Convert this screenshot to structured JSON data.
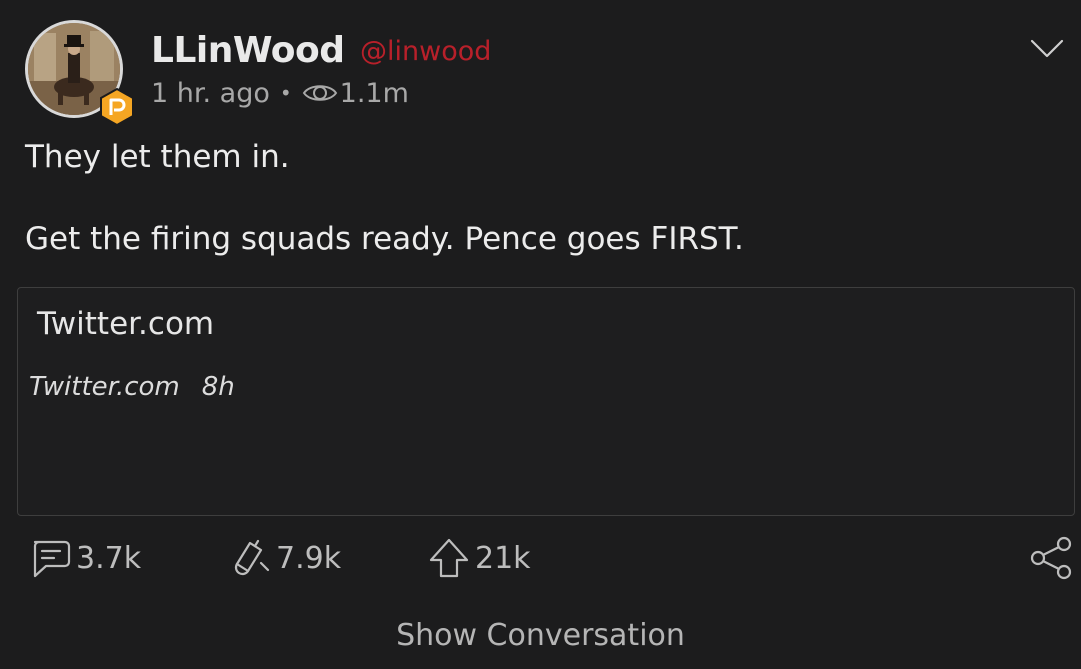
{
  "post": {
    "display_name": "LLinWood",
    "handle": "@linwood",
    "time_ago": "1 hr. ago",
    "separator": "•",
    "views": "1.1m",
    "text_line1": "They let them in.",
    "text_line2": "Get the firing squads ready. Pence goes FIRST.",
    "icons": {
      "avatar": "avatar-photo",
      "badge": "parler-badge-icon",
      "views": "eye-icon",
      "menu": "chevron-down-icon"
    }
  },
  "link_card": {
    "title": "Twitter.com",
    "source": "Twitter.com",
    "age": "8h"
  },
  "actions": {
    "comments": "3.7k",
    "echoes": "7.9k",
    "votes": "21k",
    "icons": {
      "comments": "comment-icon",
      "echoes": "echo-icon",
      "votes": "upvote-icon",
      "share": "share-icon"
    }
  },
  "footer": {
    "show_conversation": "Show Conversation"
  },
  "colors": {
    "background": "#1c1c1d",
    "handle": "#b8202a",
    "badge": "#f5a623",
    "text": "#ececec",
    "muted": "#a8a8a8"
  }
}
